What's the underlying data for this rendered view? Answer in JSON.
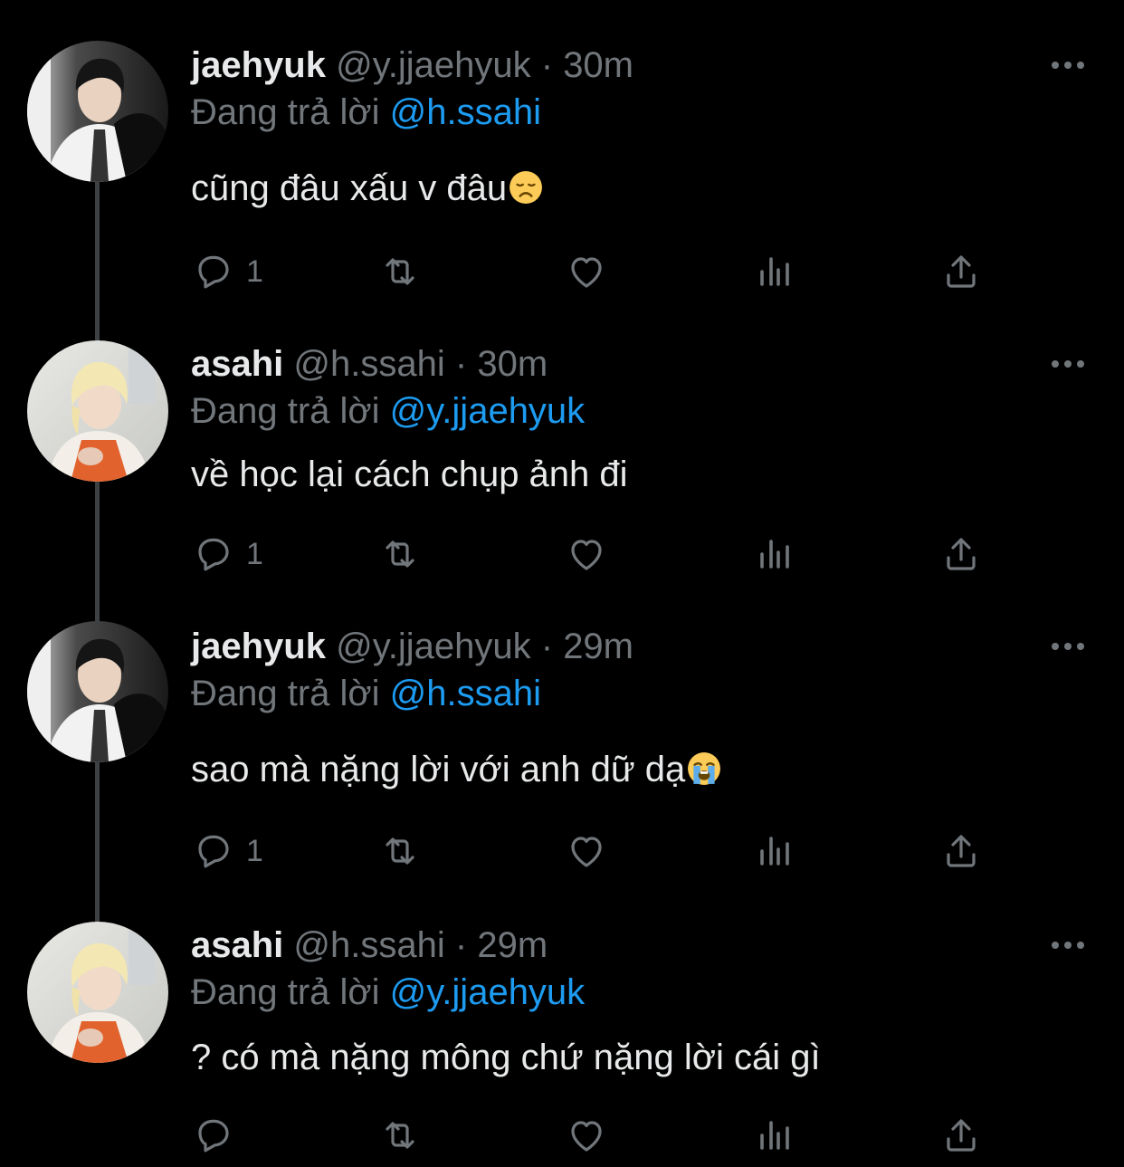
{
  "tweets": [
    {
      "name": "jaehyuk",
      "handle": "@y.jjaehyuk",
      "separator": "·",
      "time": "30m",
      "replying_prefix": "Đang trả lời",
      "replying_to": "@h.ssahi",
      "text": "cũng đâu xấu v đâu",
      "emoji": "disappointed-face",
      "reply_count": "1",
      "avatar": "jaehyuk-avatar"
    },
    {
      "name": "asahi",
      "handle": "@h.ssahi",
      "separator": "·",
      "time": "30m",
      "replying_prefix": "Đang trả lời",
      "replying_to": "@y.jjaehyuk",
      "text": "về học lại cách chụp ảnh đi",
      "reply_count": "1",
      "avatar": "asahi-avatar"
    },
    {
      "name": "jaehyuk",
      "handle": "@y.jjaehyuk",
      "separator": "·",
      "time": "29m",
      "replying_prefix": "Đang trả lời",
      "replying_to": "@h.ssahi",
      "text": "sao mà nặng lời với anh dữ dạ",
      "emoji": "loudly-crying-face",
      "reply_count": "1",
      "avatar": "jaehyuk-avatar"
    },
    {
      "name": "asahi",
      "handle": "@h.ssahi",
      "separator": "·",
      "time": "29m",
      "replying_prefix": "Đang trả lời",
      "replying_to": "@y.jjaehyuk",
      "text": "? có mà nặng mông chứ nặng lời cái gì",
      "reply_count": "",
      "avatar": "asahi-avatar"
    }
  ],
  "colors": {
    "background": "#000000",
    "text": "#e7e9ea",
    "muted": "#71767b",
    "accent": "#1d9bf0",
    "thread_line": "#3e4144"
  },
  "icons": [
    "reply-icon",
    "retweet-icon",
    "like-icon",
    "analytics-icon",
    "share-icon",
    "more-icon"
  ]
}
